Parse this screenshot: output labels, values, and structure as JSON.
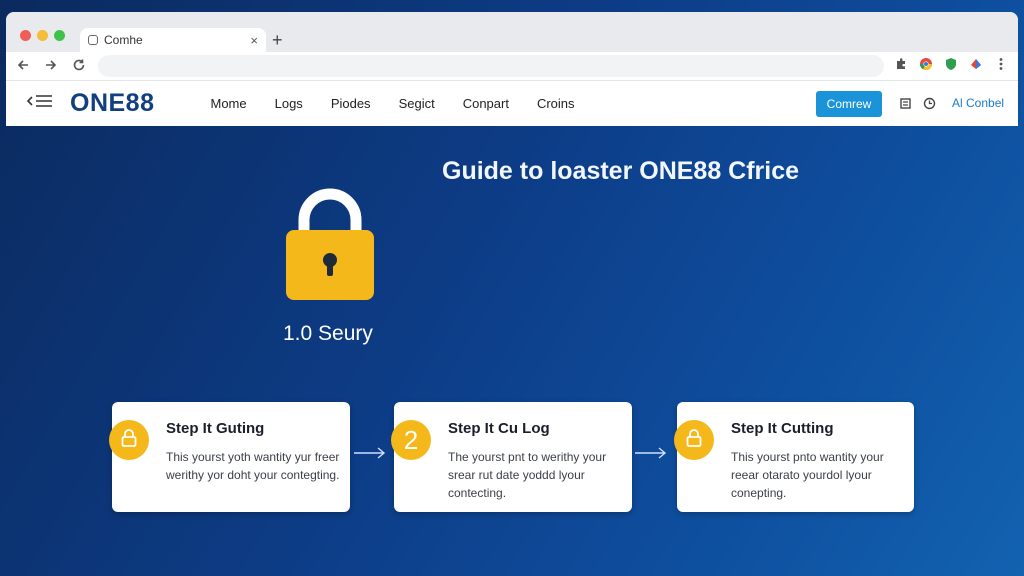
{
  "browser": {
    "tab_title": "Comhe",
    "new_tab_symbol": "+",
    "tab_close_symbol": "×",
    "traffic_lights": [
      "#ee5e57",
      "#f4bd3a",
      "#3fc24a"
    ],
    "nav_icons": [
      "back-arrow-icon",
      "forward-arrow-icon",
      "reload-icon"
    ],
    "extension_icons": [
      "puzzle-icon",
      "chrome-icon",
      "shield-icon",
      "extension-icon",
      "kebab-menu-icon"
    ]
  },
  "site": {
    "logo": "ONE88",
    "nav": [
      "Mome",
      "Logs",
      "Piodes",
      "Segict",
      "Conpart",
      "Croins"
    ],
    "cta_label": "Comrew",
    "right_link": "Al Conbel",
    "header_icons": [
      "bookmark-icon",
      "history-icon"
    ]
  },
  "hero": {
    "headline": "Guide to loaster ONE88 Cfrice",
    "lock_caption": "1.0 Seury",
    "lock_color": "#f5b81a"
  },
  "steps": [
    {
      "badge_type": "lock-icon",
      "title": "Step It Guting",
      "body": "This yourst yoth wantity yur freer werithy yor doht your contegting."
    },
    {
      "badge_type": "number",
      "badge_number": "2",
      "title": "Step It Cu Log",
      "body": "The yourst pnt to werithy your srear rut date yoddd lyour contecting."
    },
    {
      "badge_type": "lock-icon",
      "title": "Step It Cutting",
      "body": "This yourst pnto wantity your reear otarato yourdol lyour conepting."
    }
  ],
  "colors": {
    "accent_yellow": "#f5b81a",
    "cta_blue": "#1a93d8",
    "logo_navy": "#12407e"
  }
}
